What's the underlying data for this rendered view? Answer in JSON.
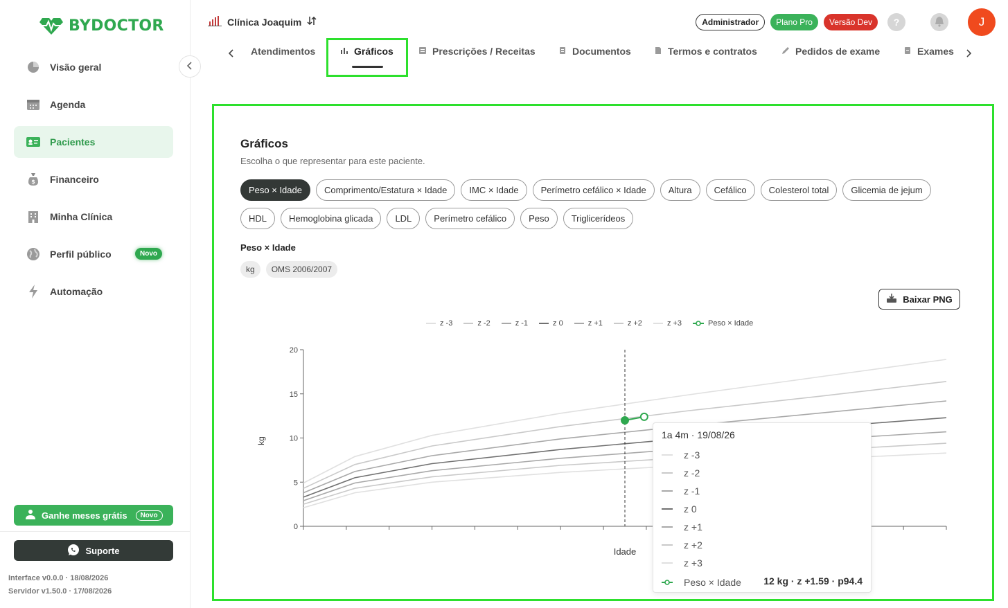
{
  "brand": {
    "name": "BYDOCTOR",
    "color": "#2fa84f"
  },
  "sidebar": {
    "items": [
      {
        "label": "Visão geral",
        "icon": "pie-chart-icon"
      },
      {
        "label": "Agenda",
        "icon": "calendar-icon"
      },
      {
        "label": "Pacientes",
        "icon": "patient-card-icon",
        "active": true
      },
      {
        "label": "Financeiro",
        "icon": "money-bag-icon"
      },
      {
        "label": "Minha Clínica",
        "icon": "building-icon"
      },
      {
        "label": "Perfil público",
        "icon": "globe-icon",
        "badge": "Novo"
      },
      {
        "label": "Automação",
        "icon": "bolt-icon"
      }
    ],
    "promo": {
      "label": "Ganhe meses grátis",
      "badge": "Novo"
    },
    "support": {
      "label": "Suporte"
    },
    "version_interface": "Interface v0.0.0 · 18/08/2026",
    "version_server": "Servidor v1.50.0 · 17/08/2026"
  },
  "header": {
    "clinic": "Clínica Joaquim",
    "badges": {
      "admin": "Administrador",
      "plan": "Plano Pro",
      "dev": "Versão Dev"
    },
    "help": "?",
    "avatar_initial": "J"
  },
  "tabs": [
    {
      "label": "Atendimentos"
    },
    {
      "label": "Gráficos",
      "active": true
    },
    {
      "label": "Prescrições / Receitas"
    },
    {
      "label": "Documentos"
    },
    {
      "label": "Termos e contratos"
    },
    {
      "label": "Pedidos de exame"
    },
    {
      "label": "Exames"
    }
  ],
  "content": {
    "title": "Gráficos",
    "subtitle": "Escolha o que representar para este paciente.",
    "chips": [
      "Peso × Idade",
      "Comprimento/Estatura × Idade",
      "IMC × Idade",
      "Perímetro cefálico × Idade",
      "Altura",
      "Cefálico",
      "Colesterol total",
      "Glicemia de jejum",
      "HDL",
      "Hemoglobina glicada",
      "LDL",
      "Perímetro cefálico",
      "Peso",
      "Triglicerídeos"
    ],
    "selected_chip": "Peso × Idade",
    "selected_title": "Peso × Idade",
    "tags": [
      "kg",
      "OMS 2006/2007"
    ],
    "download_label": "Baixar PNG"
  },
  "chart_data": {
    "type": "line",
    "xlabel": "Idade",
    "ylabel": "kg",
    "ylim": [
      0,
      20
    ],
    "yticks": [
      0,
      5,
      10,
      15,
      20
    ],
    "xlim": [
      0,
      100
    ],
    "legend_position": "top",
    "series": [
      {
        "name": "z -3",
        "color": "#e0e0e0",
        "x": [
          0,
          8,
          20,
          40,
          60,
          80,
          100
        ],
        "values": [
          2.1,
          3.8,
          5.0,
          6.1,
          6.9,
          7.6,
          8.3
        ]
      },
      {
        "name": "z -2",
        "color": "#c9c9c9",
        "x": [
          0,
          8,
          20,
          40,
          60,
          80,
          100
        ],
        "values": [
          2.5,
          4.3,
          5.6,
          6.9,
          7.8,
          8.6,
          9.4
        ]
      },
      {
        "name": "z -1",
        "color": "#a8a8a8",
        "x": [
          0,
          8,
          20,
          40,
          60,
          80,
          100
        ],
        "values": [
          2.9,
          4.9,
          6.3,
          7.7,
          8.8,
          9.8,
          10.7
        ]
      },
      {
        "name": "z 0",
        "color": "#707070",
        "x": [
          0,
          8,
          20,
          40,
          60,
          80,
          100
        ],
        "values": [
          3.3,
          5.5,
          7.1,
          8.7,
          10.0,
          11.2,
          12.3
        ]
      },
      {
        "name": "z +1",
        "color": "#a8a8a8",
        "x": [
          0,
          8,
          20,
          40,
          60,
          80,
          100
        ],
        "values": [
          3.8,
          6.2,
          8.0,
          9.9,
          11.4,
          12.8,
          14.2
        ]
      },
      {
        "name": "z +2",
        "color": "#c9c9c9",
        "x": [
          0,
          8,
          20,
          40,
          60,
          80,
          100
        ],
        "values": [
          4.3,
          7.0,
          9.1,
          11.3,
          13.1,
          14.7,
          16.4
        ]
      },
      {
        "name": "z +3",
        "color": "#e0e0e0",
        "x": [
          0,
          8,
          20,
          40,
          60,
          80,
          100
        ],
        "values": [
          4.9,
          7.9,
          10.3,
          12.8,
          14.9,
          16.9,
          18.9
        ]
      }
    ],
    "patient_series": {
      "name": "Peso × Idade",
      "color": "#2fa84f",
      "x": [
        50,
        53
      ],
      "values": [
        12.0,
        12.4
      ]
    },
    "cursor_x": 50,
    "tooltip": {
      "header": "1a 4m · 19/08/26",
      "rows": [
        "z -3",
        "z -2",
        "z -1",
        "z 0",
        "z +1",
        "z +2",
        "z +3"
      ],
      "patient_label": "Peso × Idade",
      "patient_value": "12 kg · z +1.59 · p94.4"
    }
  }
}
